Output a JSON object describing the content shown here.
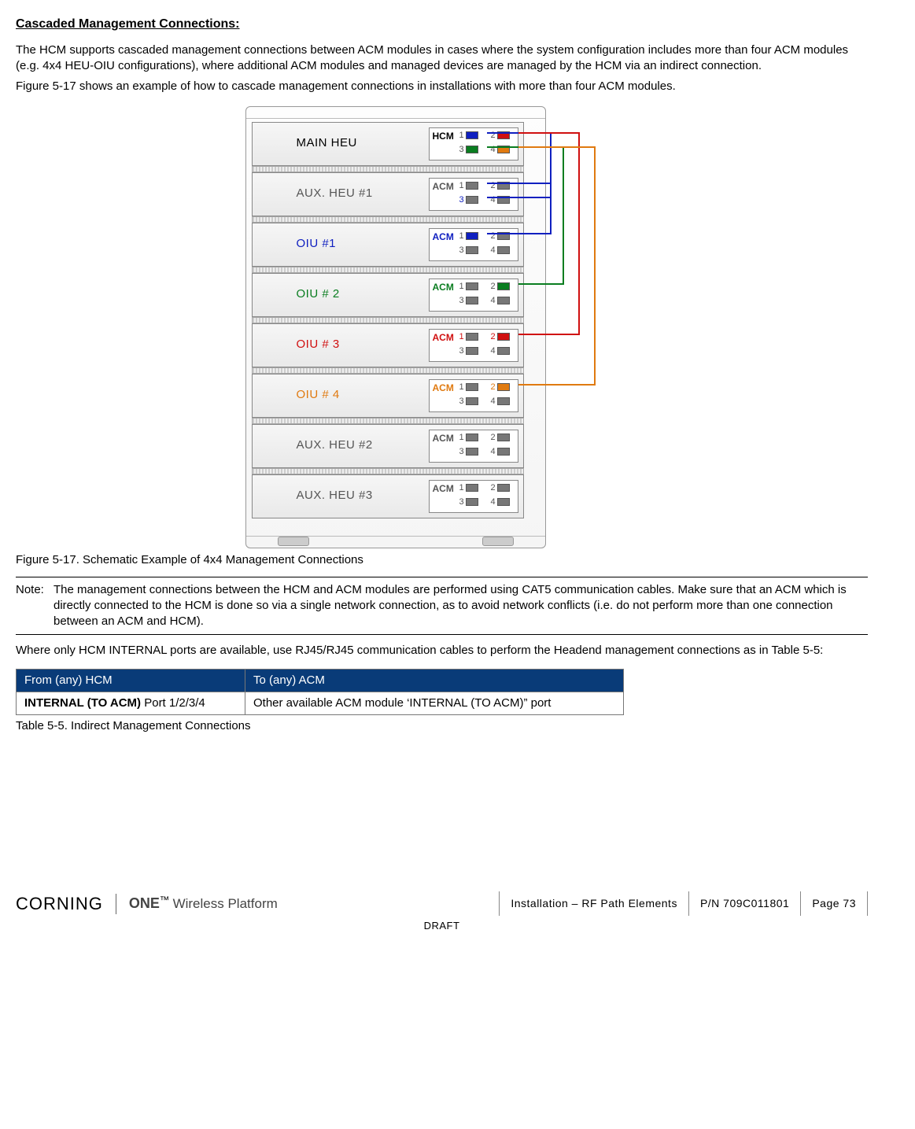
{
  "heading": "Cascaded Management Connections:",
  "para1": "The HCM supports cascaded management connections between ACM modules in cases where the system configuration includes more than four ACM modules (e.g. 4x4 HEU-OIU configurations), where additional ACM modules and managed devices are managed by the HCM via an indirect connection.",
  "para2": "Figure 5-17 shows an example of how to cascade management connections in installations with more than four ACM modules.",
  "diagram": {
    "units": [
      {
        "label": "MAIN HEU",
        "color": "#000",
        "acm": "HCM",
        "title_color": "#000"
      },
      {
        "label": "AUX. HEU #1",
        "color": "#555",
        "acm": "ACM",
        "title_color": "#555"
      },
      {
        "label": "OIU #1",
        "color": "#1020c0",
        "acm": "ACM",
        "title_color": "#1020c0"
      },
      {
        "label": "OIU # 2",
        "color": "#0a7d20",
        "acm": "ACM",
        "title_color": "#0a7d20"
      },
      {
        "label": "OIU # 3",
        "color": "#d01010",
        "acm": "ACM",
        "title_color": "#d01010"
      },
      {
        "label": "OIU # 4",
        "color": "#e07a10",
        "acm": "ACM",
        "title_color": "#e07a10"
      },
      {
        "label": "AUX. HEU #2",
        "color": "#555",
        "acm": "ACM",
        "title_color": "#555"
      },
      {
        "label": "AUX. HEU #3",
        "color": "#555",
        "acm": "ACM",
        "title_color": "#555"
      }
    ],
    "ports": [
      "1",
      "2",
      "3",
      "4"
    ]
  },
  "figcaption": "Figure 5-17. Schematic Example of 4x4 Management Connections",
  "note": {
    "label": "Note:",
    "body": "The management connections between the HCM and ACM modules are performed using CAT5 communication cables. Make sure that an ACM which is directly connected to the HCM is done so via a single network connection, as to avoid network conflicts (i.e. do not perform more than one connection between an ACM and HCM)."
  },
  "para3": "Where only HCM INTERNAL ports are available, use RJ45/RJ45 communication cables to perform the Headend management connections as in Table 5-5:",
  "table": {
    "h1": "From (any) HCM",
    "h2": "To (any) ACM",
    "c1a": "INTERNAL (TO ACM) ",
    "c1b": "Port 1/2/3/4",
    "c2": "Other available ACM module ‘INTERNAL (TO ACM)” port"
  },
  "tablecaption": "Table 5-5. Indirect Management Connections",
  "footer": {
    "brand": "CORNING",
    "one": "ONE",
    "tm": "™",
    "platform": "Wireless Platform",
    "cell1": "Installation – RF Path Elements",
    "cell2": "P/N 709C011801",
    "cell3": "Page 73",
    "draft": "DRAFT"
  }
}
